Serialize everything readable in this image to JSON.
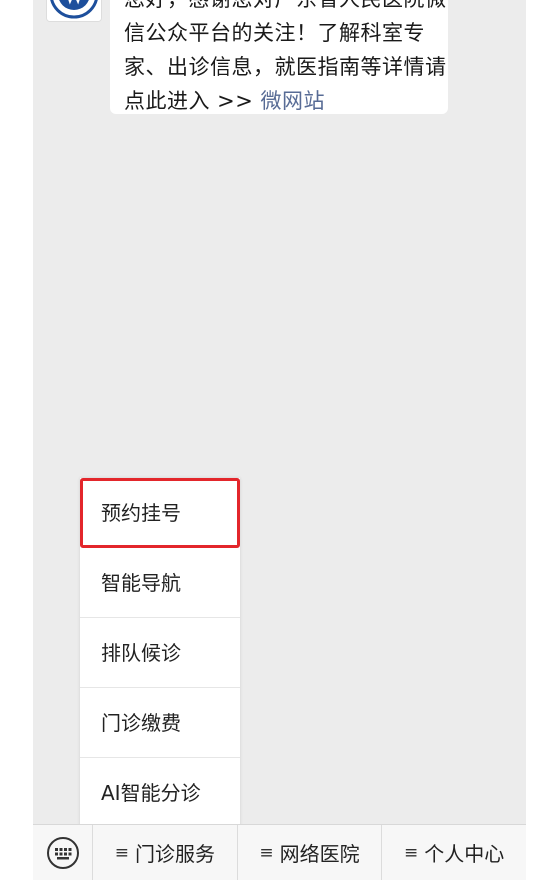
{
  "chat": {
    "message_lines": [
      "您好，感谢您对广东省人民医院微",
      "信公众平台的关注！了解科室专",
      "家、出诊信息，就医指南等详情请"
    ],
    "message_last_prefix": "点此进入 >> ",
    "message_link": "微网站"
  },
  "menu": {
    "items": [
      {
        "label": "预约挂号"
      },
      {
        "label": "智能导航"
      },
      {
        "label": "排队候诊"
      },
      {
        "label": "门诊缴费"
      },
      {
        "label": "AI智能分诊"
      }
    ]
  },
  "bottom_bar": {
    "hamburger_glyph": "≡",
    "tabs": [
      {
        "label": "门诊服务"
      },
      {
        "label": "网络医院"
      },
      {
        "label": "个人中心"
      }
    ]
  },
  "colors": {
    "link": "#576b95",
    "highlight_border": "#e3262b",
    "chat_background": "#ececec"
  }
}
